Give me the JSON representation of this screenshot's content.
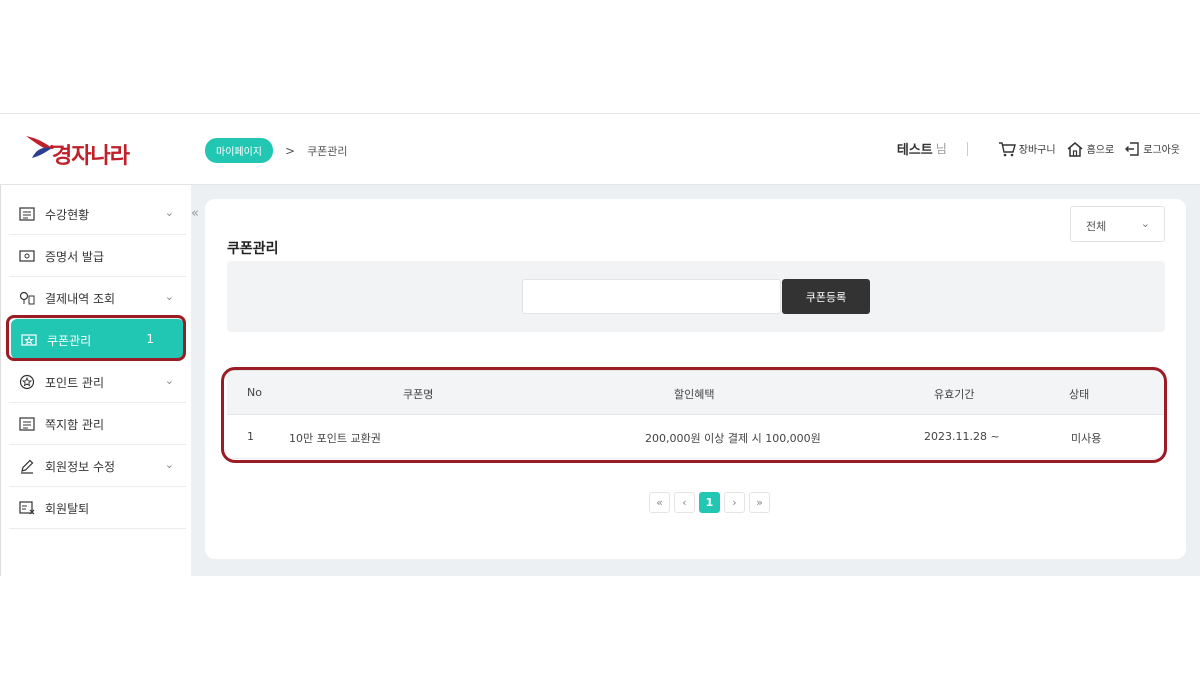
{
  "header": {
    "logo_text": "경자나라",
    "breadcrumb": {
      "home": "마이페이지",
      "separator": ">",
      "current": "쿠폰관리"
    },
    "user": {
      "name": "테스트",
      "suffix": "님"
    },
    "links": {
      "cart": "장바구니",
      "home": "홈으로",
      "logout": "로그아웃"
    }
  },
  "sidebar": {
    "collapse_glyph": "«",
    "items": [
      {
        "label": "수강현황",
        "icon": "list-icon",
        "expandable": true
      },
      {
        "label": "증명서 발급",
        "icon": "certificate-icon",
        "expandable": false
      },
      {
        "label": "결제내역 조회",
        "icon": "payment-icon",
        "expandable": true
      },
      {
        "label": "쿠폰관리",
        "icon": "coupon-icon",
        "expandable": false,
        "active": true,
        "count": "1"
      },
      {
        "label": "포인트 관리",
        "icon": "point-icon",
        "expandable": true
      },
      {
        "label": "쪽지함 관리",
        "icon": "message-icon",
        "expandable": false
      },
      {
        "label": "회원정보 수정",
        "icon": "pencil-icon",
        "expandable": true
      },
      {
        "label": "회원탈퇴",
        "icon": "withdraw-icon",
        "expandable": false
      }
    ]
  },
  "main": {
    "title": "쿠폰관리",
    "filter": {
      "selected": "전체"
    },
    "register": {
      "input_value": "",
      "button_label": "쿠폰등록"
    },
    "table": {
      "headers": {
        "no": "No",
        "name": "쿠폰명",
        "benefit": "할인혜택",
        "period": "유효기간",
        "status": "상태"
      },
      "rows": [
        {
          "no": "1",
          "name": "10만 포인트 교환권",
          "benefit": "200,000원 이상 결제 시 100,000원",
          "period": "2023.11.28 ~",
          "status": "미사용"
        }
      ]
    },
    "pagination": {
      "first": "«",
      "prev": "‹",
      "current": "1",
      "next": "›",
      "last": "»"
    }
  },
  "colors": {
    "accent": "#22c7b4",
    "highlight": "#9b1c25",
    "brand": "#c0202a",
    "dark_button": "#333333"
  }
}
